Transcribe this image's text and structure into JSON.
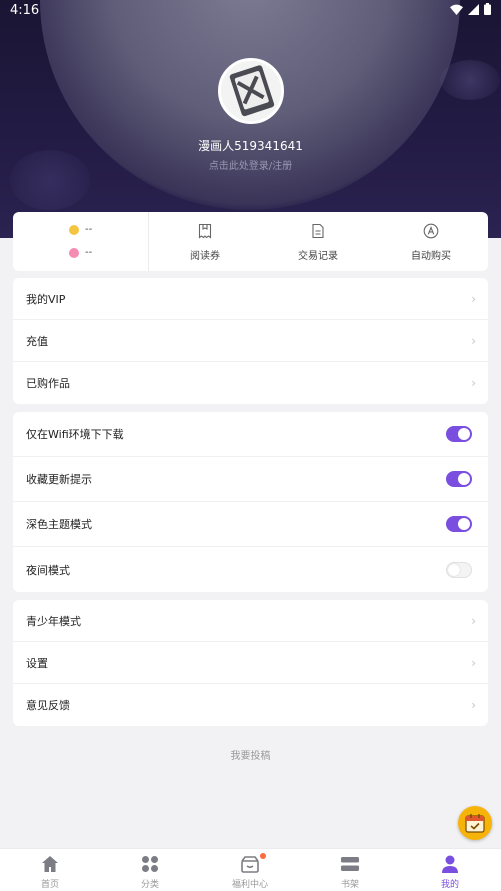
{
  "status_bar": {
    "time": "4:16"
  },
  "profile": {
    "username": "漫画人519341641",
    "login_hint": "点击此处登录/注册"
  },
  "balances": [
    {
      "icon": "gold-coin-icon",
      "value": "--",
      "color": "#f5c542"
    },
    {
      "icon": "pink-coin-icon",
      "value": "--",
      "color": "#f58bb0"
    }
  ],
  "quick_actions": [
    {
      "icon": "ticket-icon",
      "label": "阅读券"
    },
    {
      "icon": "document-icon",
      "label": "交易记录"
    },
    {
      "icon": "auto-buy-icon",
      "label": "自动购买"
    }
  ],
  "menu_group_1": [
    {
      "label": "我的VIP"
    },
    {
      "label": "充值"
    },
    {
      "label": "已购作品"
    }
  ],
  "settings_toggles": [
    {
      "label": "仅在Wifi环境下下载",
      "enabled": true
    },
    {
      "label": "收藏更新提示",
      "enabled": true
    },
    {
      "label": "深色主题模式",
      "enabled": true
    },
    {
      "label": "夜间模式",
      "enabled": false
    }
  ],
  "menu_group_2": [
    {
      "label": "青少年模式"
    },
    {
      "label": "设置"
    },
    {
      "label": "意见反馈"
    }
  ],
  "submit_link": "我要投稿",
  "tabs": [
    {
      "label": "首页",
      "icon": "home-icon"
    },
    {
      "label": "分类",
      "icon": "grid-icon"
    },
    {
      "label": "福利中心",
      "icon": "gift-icon"
    },
    {
      "label": "书架",
      "icon": "bookshelf-icon"
    },
    {
      "label": "我的",
      "icon": "user-icon",
      "active": true
    }
  ],
  "colors": {
    "accent": "#7a4fe0",
    "header_bg": "#221b44",
    "checkin": "#f6b30a"
  }
}
